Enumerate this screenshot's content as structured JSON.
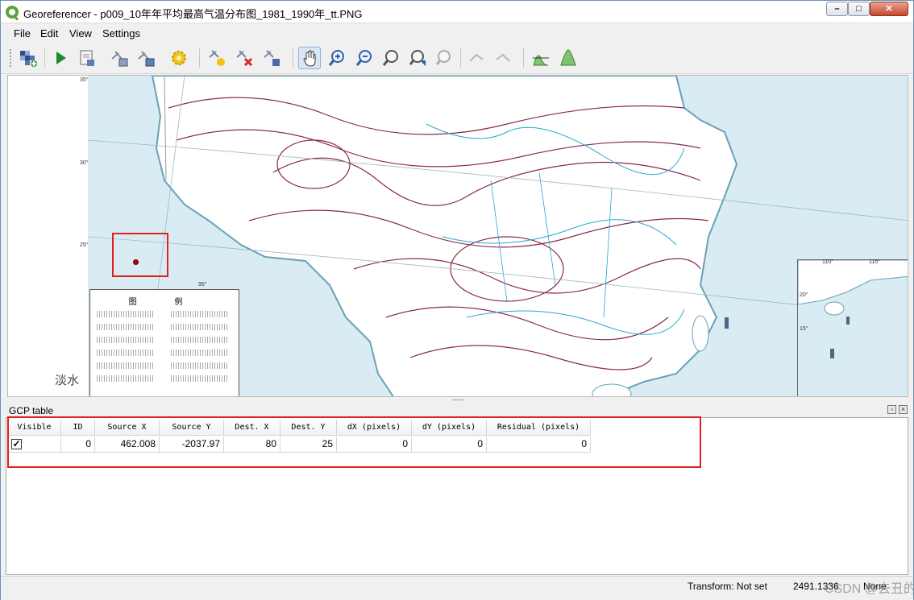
{
  "window": {
    "title": "Georeferencer - p009_10年年平均最高气温分布图_1981_1990年_tt.PNG",
    "controls": {
      "minimize": "–",
      "maximize": "□",
      "close": "✕"
    }
  },
  "menu": [
    "File",
    "Edit",
    "View",
    "Settings"
  ],
  "toolbar": {
    "buttons": [
      "open-raster-icon",
      "start-georeferencing-icon",
      "generate-gdal-script-icon",
      "load-gcp-points-icon",
      "save-gcp-points-icon",
      "transformation-settings-icon",
      "add-point-icon",
      "delete-point-icon",
      "move-gcp-point-icon",
      "pan-icon",
      "zoom-in-icon",
      "zoom-out-icon",
      "zoom-to-layer-icon",
      "zoom-last-icon",
      "zoom-next-icon",
      "link-georef-to-qgis-icon",
      "link-qgis-to-georef-icon",
      "full-histogram-stretch-icon",
      "local-histogram-stretch-icon"
    ],
    "active": "pan-icon"
  },
  "map": {
    "coord_labels": [
      "35°",
      "30°",
      "25°",
      "95°",
      "20°",
      "15°",
      "110°",
      "115°"
    ],
    "legend_title": "图 例",
    "side_text": "淡水"
  },
  "gcp_panel": {
    "title": "GCP table",
    "columns": [
      "Visible",
      "ID",
      "Source X",
      "Source Y",
      "Dest. X",
      "Dest. Y",
      "dX (pixels)",
      "dY (pixels)",
      "Residual (pixels)"
    ],
    "rows": [
      {
        "visible": "✓",
        "id": "0",
        "source_x": "462.008",
        "source_y": "-2037.97",
        "dest_x": "80",
        "dest_y": "25",
        "dx": "0",
        "dy": "0",
        "residual": "0"
      }
    ]
  },
  "status": {
    "transform": "Transform: Not set",
    "coord": "2491.1336",
    "srs": "None"
  },
  "watermark": "CSDN @去丑的星"
}
